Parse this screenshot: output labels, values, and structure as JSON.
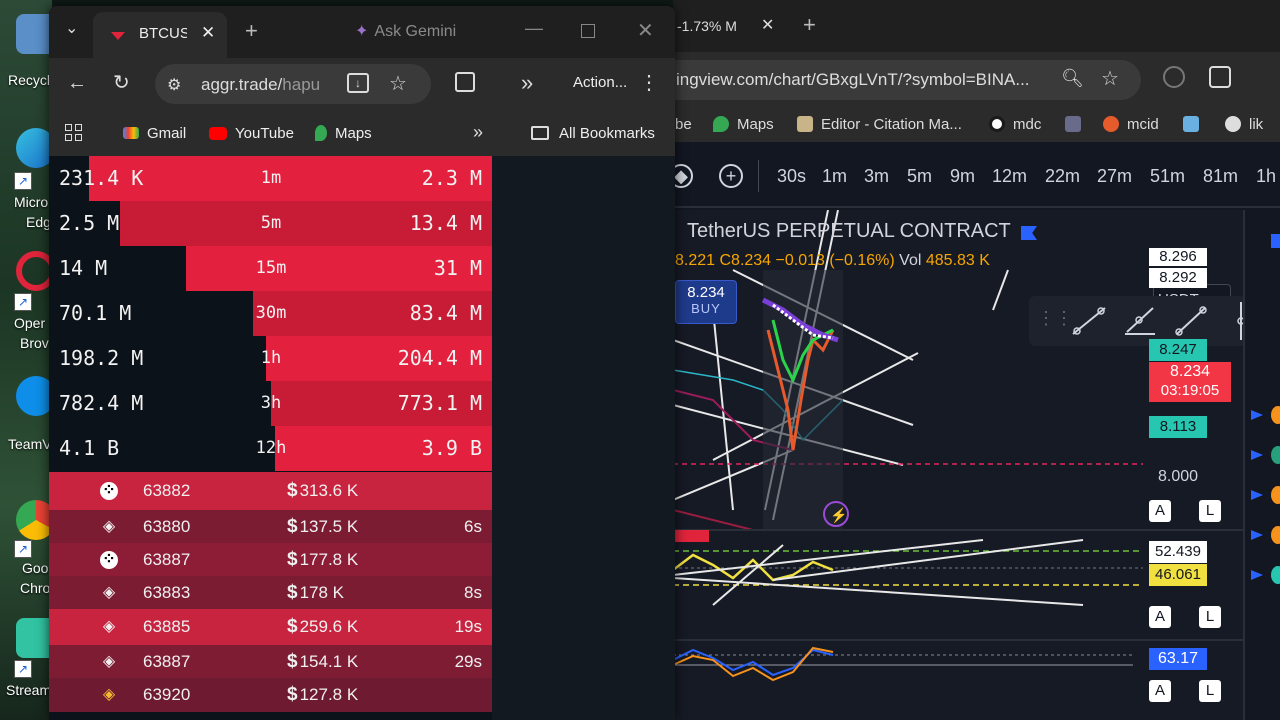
{
  "desktop": {
    "icons": [
      "Recycl",
      "Micro",
      "Edg",
      "Oper",
      "Brov",
      "TeamV",
      "Goo",
      "Chro",
      "Stream"
    ]
  },
  "front_browser": {
    "tab_title": "BTCUSD",
    "gemini": "Ask Gemini",
    "url_host": "aggr.trade/",
    "url_path": "hapu",
    "action_label": "Action...",
    "bookmarks": [
      "Gmail",
      "YouTube",
      "Maps"
    ],
    "all_bookmarks": "All Bookmarks"
  },
  "aggr": {
    "stats": [
      {
        "buy": "231.4 K",
        "tf": "1m",
        "sell": "2.3 M"
      },
      {
        "buy": "2.5 M",
        "tf": "5m",
        "sell": "13.4 M"
      },
      {
        "buy": "14 M",
        "tf": "15m",
        "sell": "31 M"
      },
      {
        "buy": "70.1 M",
        "tf": "30m",
        "sell": "83.4 M"
      },
      {
        "buy": "198.2 M",
        "tf": "1h",
        "sell": "204.4 M"
      },
      {
        "buy": "782.4 M",
        "tf": "3h",
        "sell": "773.1 M"
      },
      {
        "buy": "4.1 B",
        "tf": "12h",
        "sell": "3.9 B"
      }
    ],
    "stat_sell_ratio": [
      0.91,
      0.84,
      0.69,
      0.54,
      0.51,
      0.5,
      0.49
    ],
    "trades": [
      {
        "exchange_icon": "okx-icon",
        "price": "63882",
        "amount": "313.6 K",
        "time": ""
      },
      {
        "exchange_icon": "binance-icon",
        "price": "63880",
        "amount": "137.5 K",
        "time": "6s"
      },
      {
        "exchange_icon": "okx-icon",
        "price": "63887",
        "amount": "177.8 K",
        "time": ""
      },
      {
        "exchange_icon": "binance-icon",
        "price": "63883",
        "amount": "178 K",
        "time": "8s"
      },
      {
        "exchange_icon": "binance-icon",
        "price": "63885",
        "amount": "259.6 K",
        "time": "19s"
      },
      {
        "exchange_icon": "binance-icon",
        "price": "63887",
        "amount": "154.1 K",
        "time": "29s"
      },
      {
        "exchange_icon": "binance-gold-icon",
        "price": "63920",
        "amount": "127.8 K",
        "time": ""
      }
    ],
    "currency_symbol": "$"
  },
  "back_browser": {
    "tab_title": "-1.73% M",
    "url": "ingview.com/chart/GBxgLVnT/?symbol=BINA...",
    "bookmarks": [
      "be",
      "Maps",
      "Editor - Citation Ma...",
      "mdc",
      "mcid",
      "lik"
    ]
  },
  "tradingview": {
    "timeframes": [
      "30s",
      "1m",
      "3m",
      "5m",
      "9m",
      "12m",
      "22m",
      "27m",
      "51m",
      "81m",
      "1h"
    ],
    "title": "TetherUS PERPETUAL CONTRACT",
    "ohlc": "8.221 C8.234 −0.013 (−0.16%)",
    "vol_label": "Vol",
    "vol_value": "485.83 K",
    "buy_price": "8.234",
    "buy_label": "BUY",
    "currency": "USDT",
    "prices": [
      "8.296",
      "8.292",
      "8.247",
      "8.234",
      "03:19:05",
      "8.113",
      "8.000",
      "52.439",
      "46.061",
      "63.17"
    ],
    "a_label": "A",
    "l_label": "L"
  }
}
